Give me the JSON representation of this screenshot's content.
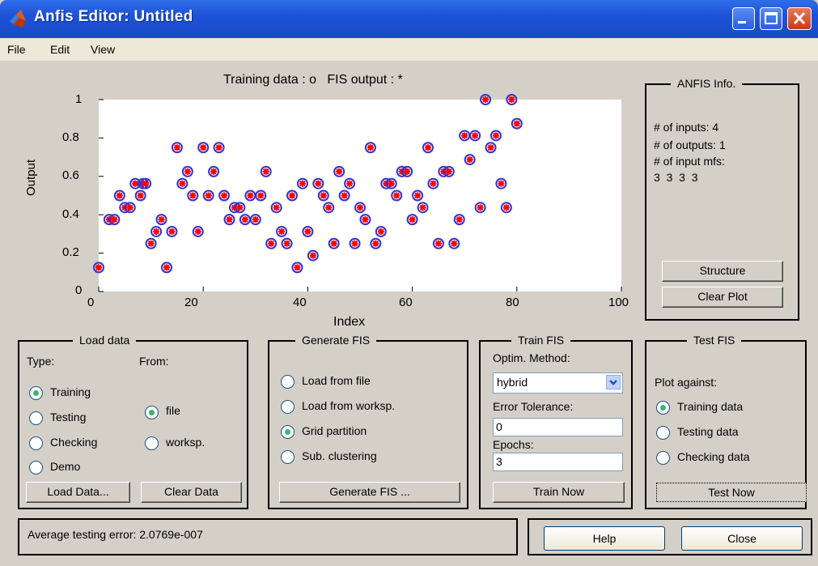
{
  "window": {
    "title": "Anfis Editor: Untitled"
  },
  "menu": [
    "File",
    "Edit",
    "View"
  ],
  "plot": {
    "title": "Training data : o   FIS output : *",
    "xlabel": "Index",
    "ylabel": "Output"
  },
  "chart_data": {
    "type": "scatter",
    "title": "Training data : o   FIS output : *",
    "xlabel": "Index",
    "ylabel": "Output",
    "xlim": [
      0,
      100
    ],
    "ylim": [
      0,
      1
    ],
    "xticks": [
      "0",
      "20",
      "40",
      "60",
      "80",
      "100"
    ],
    "yticks": [
      "0",
      "0.2",
      "0.4",
      "0.6",
      "0.8",
      "1"
    ],
    "marker_colors": {
      "training": "#3333cc",
      "fis_output": "#ff0000"
    },
    "points": [
      [
        0,
        0.125
      ],
      [
        2,
        0.375
      ],
      [
        3,
        0.375
      ],
      [
        4,
        0.5
      ],
      [
        5,
        0.4375
      ],
      [
        6,
        0.4375
      ],
      [
        7,
        0.5625
      ],
      [
        8,
        0.5
      ],
      [
        8.5,
        0.5625
      ],
      [
        9,
        0.5625
      ],
      [
        10,
        0.25
      ],
      [
        11,
        0.3125
      ],
      [
        12,
        0.375
      ],
      [
        13,
        0.125
      ],
      [
        14,
        0.3125
      ],
      [
        15,
        0.75
      ],
      [
        16,
        0.5625
      ],
      [
        17,
        0.625
      ],
      [
        18,
        0.5
      ],
      [
        19,
        0.3125
      ],
      [
        20,
        0.75
      ],
      [
        21,
        0.5
      ],
      [
        22,
        0.625
      ],
      [
        23,
        0.75
      ],
      [
        24,
        0.5
      ],
      [
        25,
        0.375
      ],
      [
        26,
        0.4375
      ],
      [
        27,
        0.4375
      ],
      [
        28,
        0.375
      ],
      [
        29,
        0.5
      ],
      [
        30,
        0.375
      ],
      [
        31,
        0.5
      ],
      [
        32,
        0.625
      ],
      [
        33,
        0.25
      ],
      [
        34,
        0.4375
      ],
      [
        35,
        0.3125
      ],
      [
        36,
        0.25
      ],
      [
        37,
        0.5
      ],
      [
        38,
        0.125
      ],
      [
        39,
        0.5625
      ],
      [
        40,
        0.3125
      ],
      [
        41,
        0.1875
      ],
      [
        42,
        0.5625
      ],
      [
        43,
        0.5
      ],
      [
        44,
        0.4375
      ],
      [
        45,
        0.25
      ],
      [
        46,
        0.625
      ],
      [
        47,
        0.5
      ],
      [
        48,
        0.5625
      ],
      [
        49,
        0.25
      ],
      [
        50,
        0.4375
      ],
      [
        51,
        0.375
      ],
      [
        52,
        0.75
      ],
      [
        53,
        0.25
      ],
      [
        54,
        0.3125
      ],
      [
        55,
        0.5625
      ],
      [
        56,
        0.5625
      ],
      [
        57,
        0.5
      ],
      [
        58,
        0.625
      ],
      [
        59,
        0.625
      ],
      [
        60,
        0.375
      ],
      [
        61,
        0.5
      ],
      [
        62,
        0.4375
      ],
      [
        63,
        0.75
      ],
      [
        64,
        0.5625
      ],
      [
        65,
        0.25
      ],
      [
        66,
        0.625
      ],
      [
        67,
        0.625
      ],
      [
        68,
        0.25
      ],
      [
        69,
        0.375
      ],
      [
        70,
        0.8125
      ],
      [
        71,
        0.6875
      ],
      [
        72,
        0.8125
      ],
      [
        73,
        0.4375
      ],
      [
        74,
        1
      ],
      [
        75,
        0.75
      ],
      [
        76,
        0.8125
      ],
      [
        77,
        0.5625
      ],
      [
        78,
        0.4375
      ],
      [
        79,
        1
      ],
      [
        80,
        0.875
      ]
    ]
  },
  "anfis_info": {
    "title": "ANFIS Info.",
    "inputs": "# of inputs: 4",
    "outputs": "# of outputs: 1",
    "input_mfs_label": "# of input mfs:",
    "input_mfs_value": "3  3  3  3",
    "structure_button": "Structure",
    "clear_plot_button": "Clear Plot"
  },
  "load_data": {
    "title": "Load data",
    "type_label": "Type:",
    "from_label": "From:",
    "types": [
      "Training",
      "Testing",
      "Checking",
      "Demo"
    ],
    "from": [
      "file",
      "worksp."
    ],
    "load_button": "Load Data...",
    "clear_button": "Clear Data"
  },
  "generate_fis": {
    "title": "Generate FIS",
    "options": [
      "Load from file",
      "Load from worksp.",
      "Grid partition",
      "Sub. clustering"
    ],
    "button": "Generate FIS ..."
  },
  "train_fis": {
    "title": "Train FIS",
    "method_label": "Optim. Method:",
    "method_value": "hybrid",
    "tolerance_label": "Error Tolerance:",
    "tolerance_value": "0",
    "epochs_label": "Epochs:",
    "epochs_value": "3",
    "button": "Train Now"
  },
  "test_fis": {
    "title": "Test FIS",
    "plot_against_label": "Plot against:",
    "options": [
      "Training data",
      "Testing data",
      "Checking data"
    ],
    "button": "Test Now"
  },
  "status": {
    "text": "Average testing error: 2.0769e-007"
  },
  "footer": {
    "help": "Help",
    "close": "Close"
  }
}
